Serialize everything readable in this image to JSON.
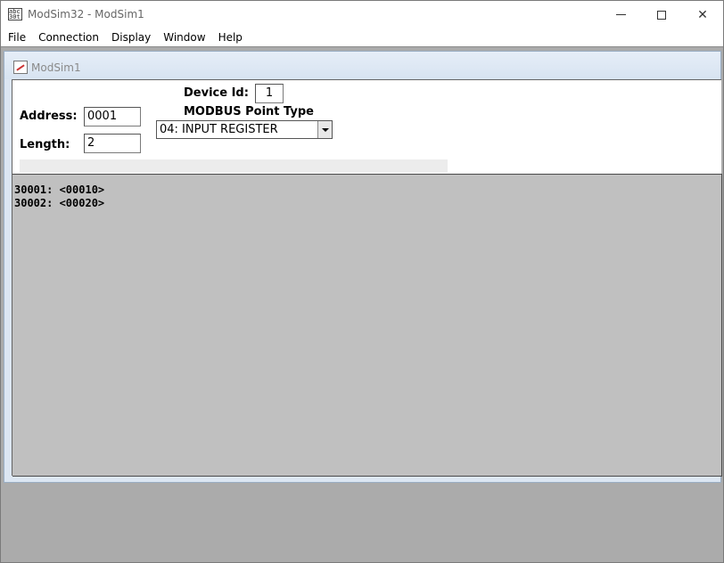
{
  "app": {
    "title": "ModSim32 - ModSim1",
    "icon_lines": [
      "abc",
      "30t"
    ]
  },
  "window_controls": {
    "close_glyph": "✕"
  },
  "menu": [
    "File",
    "Connection",
    "Display",
    "Window",
    "Help"
  ],
  "child": {
    "title": "ModSim1"
  },
  "form": {
    "device_id_label": "Device Id:",
    "device_id_value": "1",
    "point_type_label": "MODBUS Point Type",
    "point_type_value": "04: INPUT REGISTER",
    "address_label": "Address:",
    "address_value": "0001",
    "length_label": "Length:",
    "length_value": "2"
  },
  "registers": [
    "30001: <00010>",
    "30002: <00020>"
  ],
  "colors": {
    "data_pane_bg": "#c0c0c0",
    "mdi_bg": "#ababab",
    "child_frame": "#dce6f2"
  }
}
